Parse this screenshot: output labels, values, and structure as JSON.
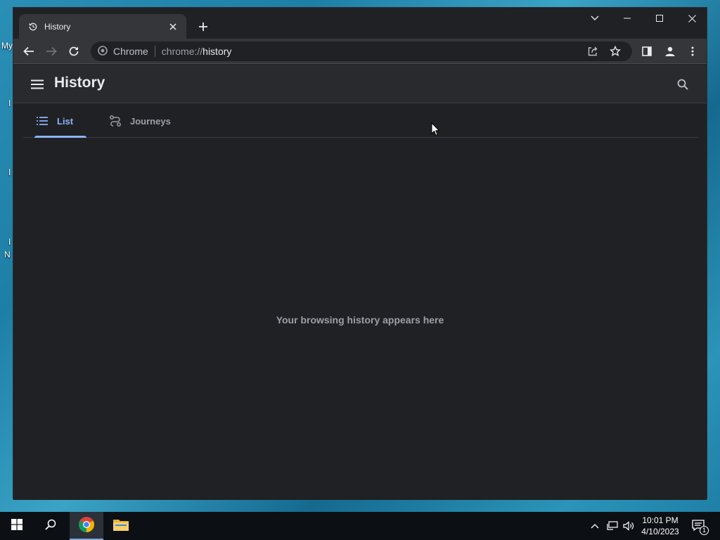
{
  "desktop": {
    "edge_labels": [
      "My",
      "I",
      "I",
      "I",
      "N"
    ]
  },
  "browser": {
    "tab": {
      "title": "History",
      "icon": "history-icon"
    },
    "omnibox": {
      "site_chip": "Chrome",
      "url_scheme": "chrome://",
      "url_path": "history"
    }
  },
  "page": {
    "title": "History",
    "tabs": [
      {
        "label": "List",
        "icon": "list-icon",
        "active": true
      },
      {
        "label": "Journeys",
        "icon": "journeys-icon",
        "active": false
      }
    ],
    "empty_message": "Your browsing history appears here"
  },
  "taskbar": {
    "time": "10:01 PM",
    "date": "4/10/2023",
    "notification_count": "1"
  },
  "colors": {
    "accent": "#8ab4f8",
    "page_bg": "#202124",
    "toolbar_bg": "#35363a",
    "header_bg": "#292a2d"
  }
}
